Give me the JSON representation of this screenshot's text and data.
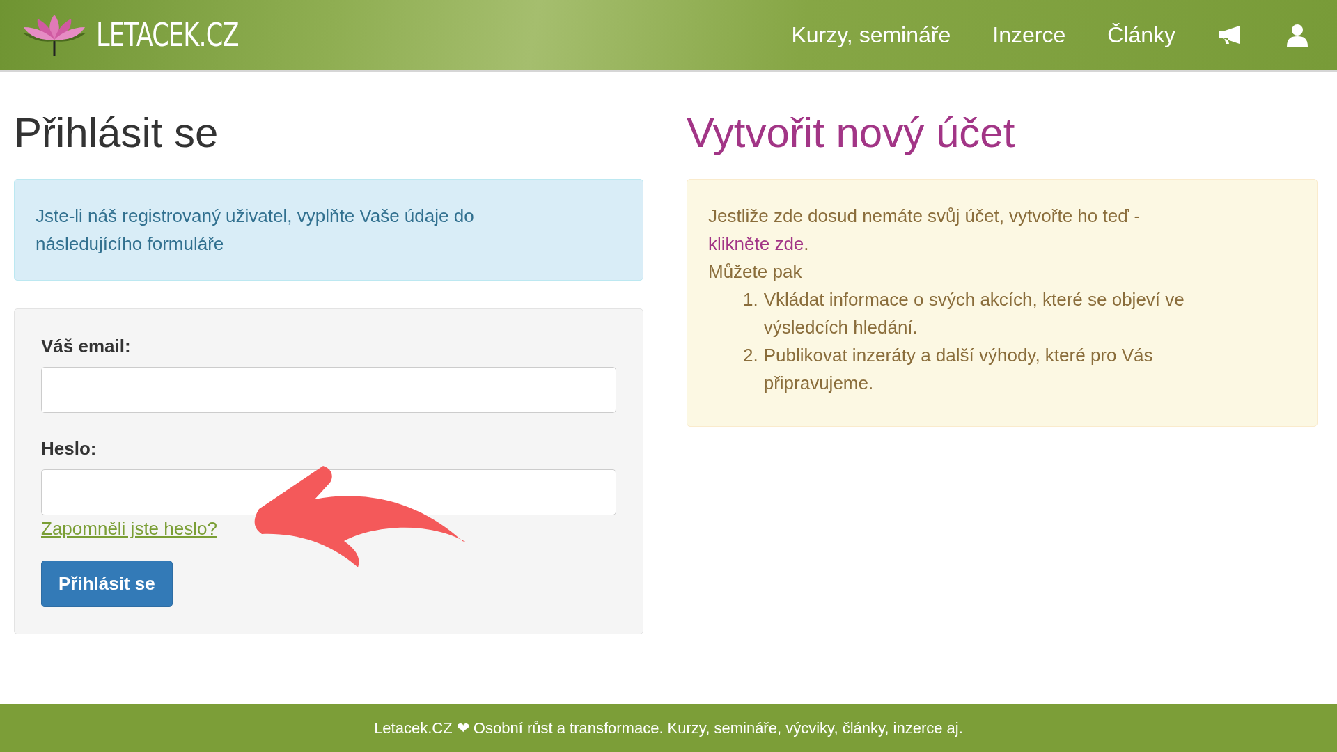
{
  "header": {
    "logo": "LETACEK.CZ",
    "nav": [
      {
        "label": "Kurzy, semináře"
      },
      {
        "label": "Inzerce"
      },
      {
        "label": "Články"
      }
    ]
  },
  "login": {
    "title": "Přihlásit se",
    "info": "Jste-li náš registrovaný uživatel, vyplňte Vaše údaje do následujícího formuláře",
    "fields": [
      {
        "label": "Váš email:"
      },
      {
        "label": "Heslo:"
      }
    ],
    "forgot_link": "Zapomněli jste heslo?",
    "submit": "Přihlásit se"
  },
  "register": {
    "title": "Vytvořit nový účet",
    "intro": "Jestliže zde dosud nemáte svůj účet, vytvořte ho teď - ",
    "link": "klikněte zde",
    "after_link": ".",
    "subintro": "Můžete pak",
    "benefits": [
      {
        "number": "1.",
        "text": "Vkládat informace o svých akcích, které se objeví ve výsledcích hledání."
      },
      {
        "number": "2.",
        "text": "Publikovat inzeráty a další výhody, které pro Vás připravujeme."
      }
    ]
  },
  "footer": {
    "text": "Letacek.CZ ❤ Osobní růst a transformace. Kurzy, semináře, výcviky, články, inzerce aj."
  }
}
